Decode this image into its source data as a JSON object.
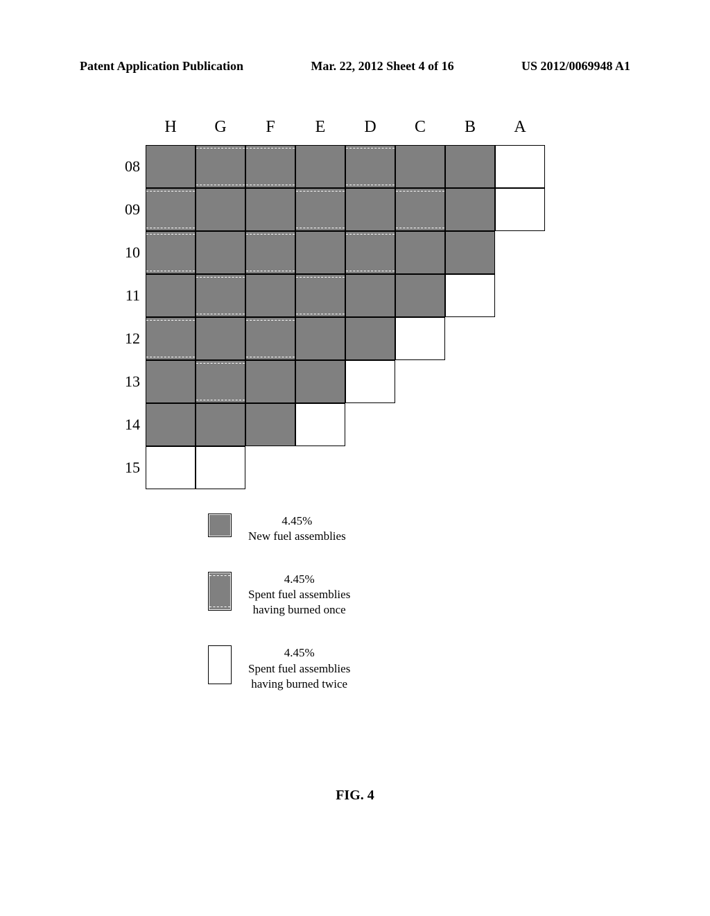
{
  "header": {
    "left": "Patent Application Publication",
    "center": "Mar. 22, 2012  Sheet 4 of 16",
    "right": "US 2012/0069948 A1"
  },
  "chart_data": {
    "type": "heatmap",
    "title": "FIG. 4",
    "columns": [
      "H",
      "G",
      "F",
      "E",
      "D",
      "C",
      "B",
      "A"
    ],
    "rows": [
      "08",
      "09",
      "10",
      "11",
      "12",
      "13",
      "14",
      "15"
    ],
    "cell_types": {
      "new": "4.45% New fuel assemblies",
      "once": "4.45% Spent fuel assemblies having burned once",
      "twice": "4.45% Spent fuel assemblies having burned twice"
    },
    "grid": [
      [
        "new",
        "once",
        "once",
        "new",
        "once",
        "new",
        "new",
        "twice"
      ],
      [
        "once",
        "new",
        "new",
        "once",
        "new",
        "once",
        "new",
        "twice"
      ],
      [
        "once",
        "new",
        "once",
        "new",
        "once",
        "new",
        "new",
        null
      ],
      [
        "new",
        "once",
        "new",
        "once",
        "new",
        "new",
        "twice",
        null
      ],
      [
        "once",
        "new",
        "once",
        "new",
        "new",
        "twice",
        null,
        null
      ],
      [
        "new",
        "once",
        "new",
        "new",
        "twice",
        null,
        null,
        null
      ],
      [
        "new",
        "new",
        "new",
        "twice",
        null,
        null,
        null,
        null
      ],
      [
        "twice",
        "twice",
        null,
        null,
        null,
        null,
        null,
        null
      ]
    ]
  },
  "legend": {
    "items": [
      {
        "enrichment": "4.45%",
        "line1": "New fuel assemblies",
        "line2": "",
        "type": "new"
      },
      {
        "enrichment": "4.45%",
        "line1": "Spent fuel assemblies",
        "line2": "having burned once",
        "type": "once"
      },
      {
        "enrichment": "4.45%",
        "line1": "Spent fuel assemblies",
        "line2": "having burned twice",
        "type": "twice"
      }
    ]
  },
  "figure_label": "FIG. 4"
}
